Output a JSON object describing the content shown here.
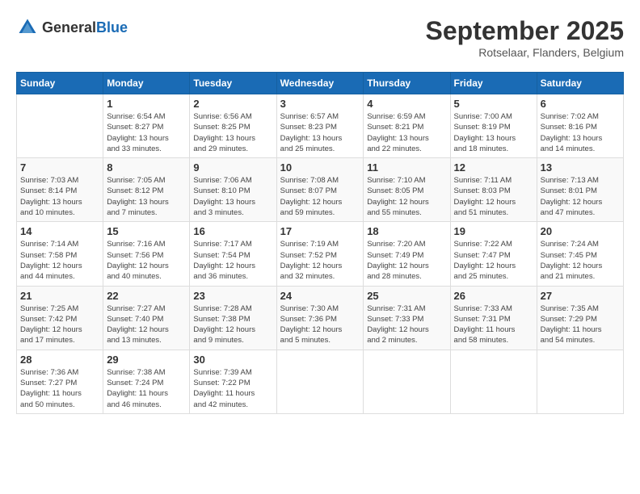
{
  "header": {
    "logo_general": "General",
    "logo_blue": "Blue",
    "month_title": "September 2025",
    "location": "Rotselaar, Flanders, Belgium"
  },
  "columns": [
    "Sunday",
    "Monday",
    "Tuesday",
    "Wednesday",
    "Thursday",
    "Friday",
    "Saturday"
  ],
  "weeks": [
    [
      {
        "day": "",
        "info": ""
      },
      {
        "day": "1",
        "info": "Sunrise: 6:54 AM\nSunset: 8:27 PM\nDaylight: 13 hours\nand 33 minutes."
      },
      {
        "day": "2",
        "info": "Sunrise: 6:56 AM\nSunset: 8:25 PM\nDaylight: 13 hours\nand 29 minutes."
      },
      {
        "day": "3",
        "info": "Sunrise: 6:57 AM\nSunset: 8:23 PM\nDaylight: 13 hours\nand 25 minutes."
      },
      {
        "day": "4",
        "info": "Sunrise: 6:59 AM\nSunset: 8:21 PM\nDaylight: 13 hours\nand 22 minutes."
      },
      {
        "day": "5",
        "info": "Sunrise: 7:00 AM\nSunset: 8:19 PM\nDaylight: 13 hours\nand 18 minutes."
      },
      {
        "day": "6",
        "info": "Sunrise: 7:02 AM\nSunset: 8:16 PM\nDaylight: 13 hours\nand 14 minutes."
      }
    ],
    [
      {
        "day": "7",
        "info": "Sunrise: 7:03 AM\nSunset: 8:14 PM\nDaylight: 13 hours\nand 10 minutes."
      },
      {
        "day": "8",
        "info": "Sunrise: 7:05 AM\nSunset: 8:12 PM\nDaylight: 13 hours\nand 7 minutes."
      },
      {
        "day": "9",
        "info": "Sunrise: 7:06 AM\nSunset: 8:10 PM\nDaylight: 13 hours\nand 3 minutes."
      },
      {
        "day": "10",
        "info": "Sunrise: 7:08 AM\nSunset: 8:07 PM\nDaylight: 12 hours\nand 59 minutes."
      },
      {
        "day": "11",
        "info": "Sunrise: 7:10 AM\nSunset: 8:05 PM\nDaylight: 12 hours\nand 55 minutes."
      },
      {
        "day": "12",
        "info": "Sunrise: 7:11 AM\nSunset: 8:03 PM\nDaylight: 12 hours\nand 51 minutes."
      },
      {
        "day": "13",
        "info": "Sunrise: 7:13 AM\nSunset: 8:01 PM\nDaylight: 12 hours\nand 47 minutes."
      }
    ],
    [
      {
        "day": "14",
        "info": "Sunrise: 7:14 AM\nSunset: 7:58 PM\nDaylight: 12 hours\nand 44 minutes."
      },
      {
        "day": "15",
        "info": "Sunrise: 7:16 AM\nSunset: 7:56 PM\nDaylight: 12 hours\nand 40 minutes."
      },
      {
        "day": "16",
        "info": "Sunrise: 7:17 AM\nSunset: 7:54 PM\nDaylight: 12 hours\nand 36 minutes."
      },
      {
        "day": "17",
        "info": "Sunrise: 7:19 AM\nSunset: 7:52 PM\nDaylight: 12 hours\nand 32 minutes."
      },
      {
        "day": "18",
        "info": "Sunrise: 7:20 AM\nSunset: 7:49 PM\nDaylight: 12 hours\nand 28 minutes."
      },
      {
        "day": "19",
        "info": "Sunrise: 7:22 AM\nSunset: 7:47 PM\nDaylight: 12 hours\nand 25 minutes."
      },
      {
        "day": "20",
        "info": "Sunrise: 7:24 AM\nSunset: 7:45 PM\nDaylight: 12 hours\nand 21 minutes."
      }
    ],
    [
      {
        "day": "21",
        "info": "Sunrise: 7:25 AM\nSunset: 7:42 PM\nDaylight: 12 hours\nand 17 minutes."
      },
      {
        "day": "22",
        "info": "Sunrise: 7:27 AM\nSunset: 7:40 PM\nDaylight: 12 hours\nand 13 minutes."
      },
      {
        "day": "23",
        "info": "Sunrise: 7:28 AM\nSunset: 7:38 PM\nDaylight: 12 hours\nand 9 minutes."
      },
      {
        "day": "24",
        "info": "Sunrise: 7:30 AM\nSunset: 7:36 PM\nDaylight: 12 hours\nand 5 minutes."
      },
      {
        "day": "25",
        "info": "Sunrise: 7:31 AM\nSunset: 7:33 PM\nDaylight: 12 hours\nand 2 minutes."
      },
      {
        "day": "26",
        "info": "Sunrise: 7:33 AM\nSunset: 7:31 PM\nDaylight: 11 hours\nand 58 minutes."
      },
      {
        "day": "27",
        "info": "Sunrise: 7:35 AM\nSunset: 7:29 PM\nDaylight: 11 hours\nand 54 minutes."
      }
    ],
    [
      {
        "day": "28",
        "info": "Sunrise: 7:36 AM\nSunset: 7:27 PM\nDaylight: 11 hours\nand 50 minutes."
      },
      {
        "day": "29",
        "info": "Sunrise: 7:38 AM\nSunset: 7:24 PM\nDaylight: 11 hours\nand 46 minutes."
      },
      {
        "day": "30",
        "info": "Sunrise: 7:39 AM\nSunset: 7:22 PM\nDaylight: 11 hours\nand 42 minutes."
      },
      {
        "day": "",
        "info": ""
      },
      {
        "day": "",
        "info": ""
      },
      {
        "day": "",
        "info": ""
      },
      {
        "day": "",
        "info": ""
      }
    ]
  ]
}
